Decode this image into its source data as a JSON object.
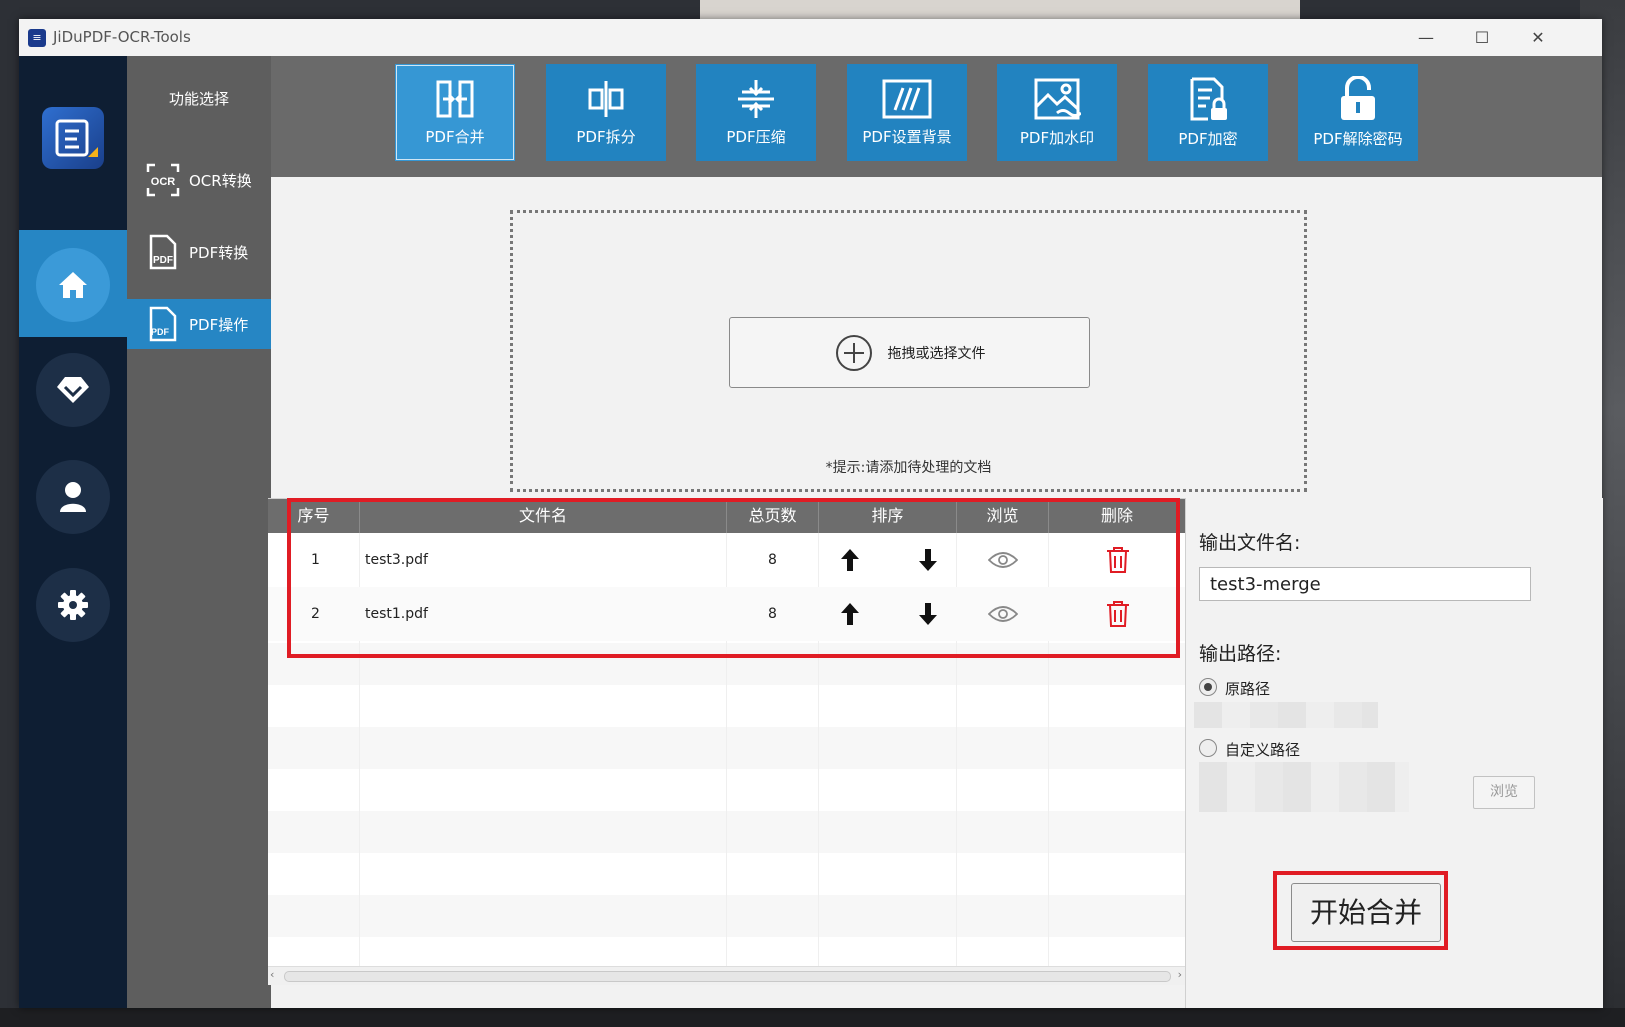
{
  "window": {
    "title": "JiDuPDF-OCR-Tools",
    "minimize": "—",
    "maximize": "☐",
    "close": "✕"
  },
  "sidebar": {
    "title": "功能选择",
    "items": [
      {
        "label": "OCR转换",
        "icon": "ocr-icon"
      },
      {
        "label": "PDF转换",
        "icon": "pdf-file-icon"
      },
      {
        "label": "PDF操作",
        "icon": "pdf-file-icon"
      }
    ]
  },
  "rail": {
    "items": [
      "home-icon",
      "diamond-icon",
      "user-icon",
      "gear-icon"
    ]
  },
  "toolbar": {
    "items": [
      {
        "label": "PDF合并",
        "icon": "merge-icon"
      },
      {
        "label": "PDF拆分",
        "icon": "split-icon"
      },
      {
        "label": "PDF压缩",
        "icon": "compress-icon"
      },
      {
        "label": "PDF设置背景",
        "icon": "background-icon"
      },
      {
        "label": "PDF加水印",
        "icon": "watermark-icon"
      },
      {
        "label": "PDF加密",
        "icon": "encrypt-icon"
      },
      {
        "label": "PDF解除密码",
        "icon": "unlock-icon"
      }
    ]
  },
  "dropzone": {
    "button_label": "拖拽或选择文件",
    "hint": "*提示:请添加待处理的文档"
  },
  "table": {
    "headers": [
      "序号",
      "文件名",
      "总页数",
      "排序",
      "浏览",
      "删除"
    ],
    "rows": [
      {
        "index": "1",
        "filename": "test3.pdf",
        "pages": "8"
      },
      {
        "index": "2",
        "filename": "test1.pdf",
        "pages": "8"
      }
    ]
  },
  "output": {
    "filename_label": "输出文件名:",
    "filename_value": "test3-merge",
    "path_label": "输出路径:",
    "option_original": "原路径",
    "option_custom": "自定义路径",
    "browse_label": "浏览",
    "start_label": "开始合并"
  },
  "colors": {
    "accent": "#2283c0",
    "highlight": "#e01c24",
    "rail": "#0e1e33"
  }
}
